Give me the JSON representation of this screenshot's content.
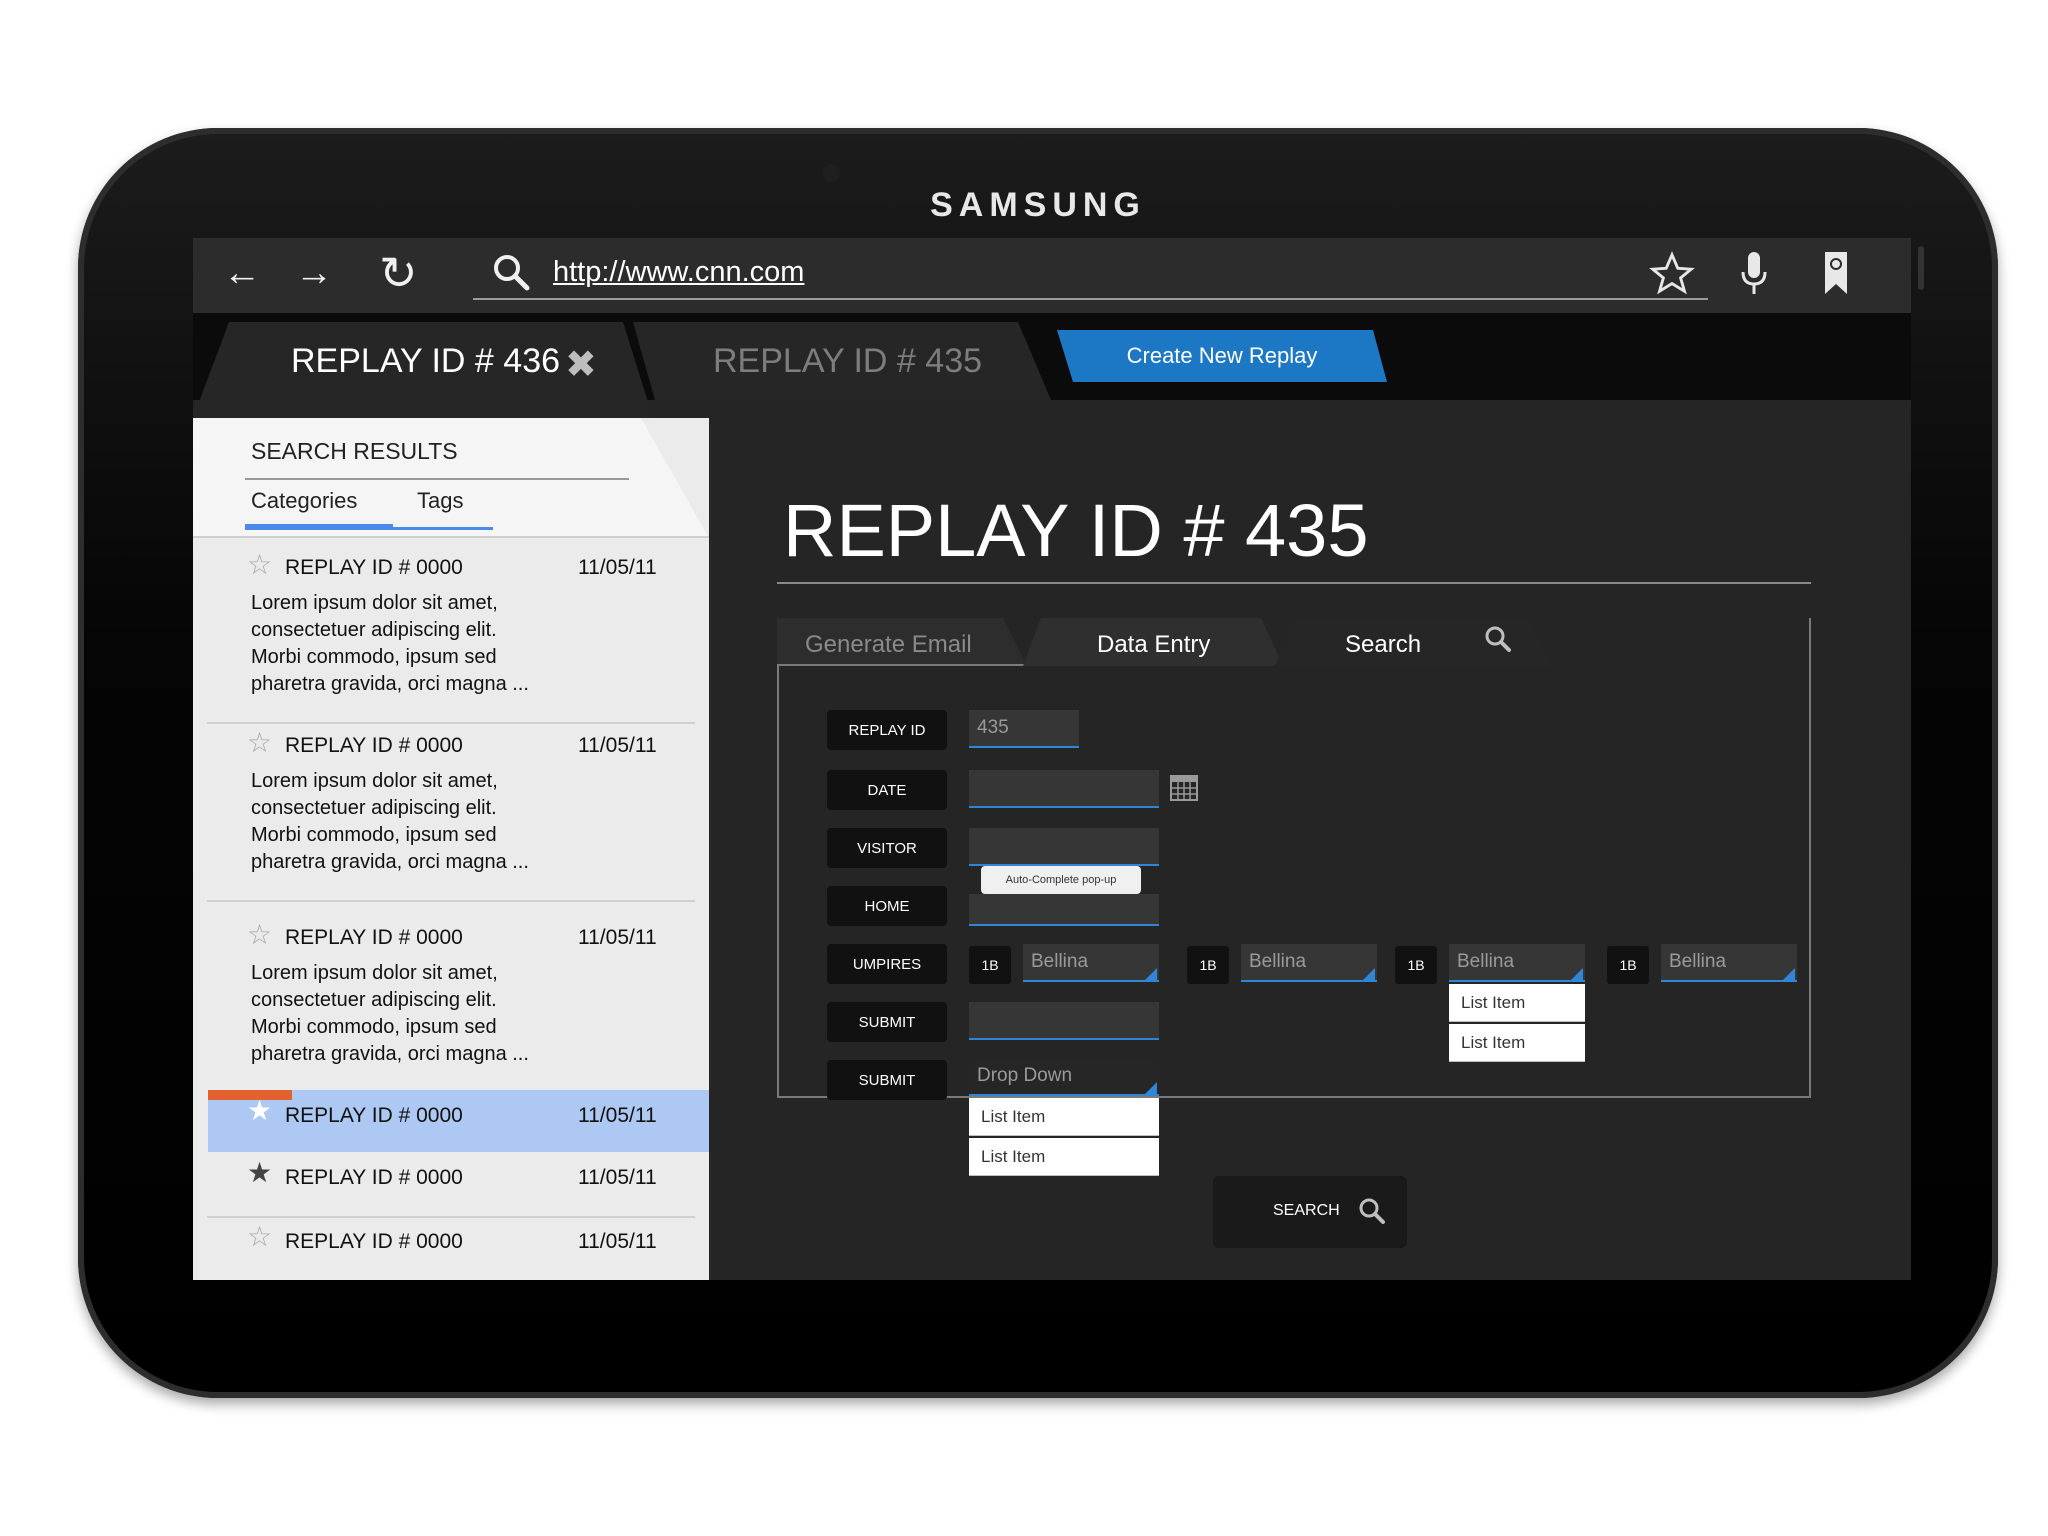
{
  "device": {
    "brand": "SAMSUNG"
  },
  "browser": {
    "url": "http://www.cnn.com",
    "icons": [
      "back-arrow-icon",
      "forward-arrow-icon",
      "refresh-icon",
      "search-icon",
      "star-icon",
      "microphone-icon",
      "bookmark-icon"
    ]
  },
  "tabs": {
    "active_label": "REPLAY ID # 436",
    "inactive_label": "REPLAY ID # 435",
    "create_new": "Create New Replay"
  },
  "results": {
    "heading": "SEARCH RESULTS",
    "tabs": [
      "Categories",
      "Tags"
    ],
    "items": [
      {
        "title": "REPLAY ID # 0000",
        "date": "11/05/11",
        "body": "Lorem ipsum dolor sit amet, consectetuer adipiscing elit. Morbi commodo, ipsum sed pharetra gravida, orci magna ...",
        "starred": false
      },
      {
        "title": "REPLAY ID # 0000",
        "date": "11/05/11",
        "body": "Lorem ipsum dolor sit amet, consectetuer adipiscing elit. Morbi commodo, ipsum sed pharetra gravida, orci magna ...",
        "starred": false
      },
      {
        "title": "REPLAY ID # 0000",
        "date": "11/05/11",
        "body": "Lorem ipsum dolor sit amet, consectetuer adipiscing elit. Morbi commodo, ipsum sed pharetra gravida, orci magna ...",
        "starred": false
      },
      {
        "title": "REPLAY ID # 0000",
        "date": "11/05/11",
        "selected": true,
        "starred": false
      },
      {
        "title": "REPLAY ID # 0000",
        "date": "11/05/11",
        "starred": true
      },
      {
        "title": "REPLAY ID # 0000",
        "date": "11/05/11",
        "starred": false
      }
    ]
  },
  "detail": {
    "title": "REPLAY ID # 435",
    "form_tabs": [
      "Generate Email",
      "Data Entry",
      "Search"
    ],
    "labels": {
      "replay_id": "REPLAY ID",
      "date": "DATE",
      "visitor": "VISITOR",
      "home": "HOME",
      "umpires": "UMPIRES",
      "submit1": "SUBMIT",
      "submit2": "SUBMIT"
    },
    "replay_id_value": "435",
    "autocomplete": "Auto-Complete pop-up",
    "umpires": [
      {
        "base": "1B",
        "name": "Bellina"
      },
      {
        "base": "1B",
        "name": "Bellina"
      },
      {
        "base": "1B",
        "name": "Bellina"
      },
      {
        "base": "1B",
        "name": "Bellina"
      }
    ],
    "umpire_list": [
      "List Item",
      "List Item"
    ],
    "dropdown_placeholder": "Drop Down",
    "dropdown_list": [
      "List Item",
      "List Item"
    ],
    "search_button": "SEARCH"
  },
  "colors": {
    "accent_blue": "#1c77c4",
    "selected_row": "#adc8f2",
    "highlight_orange": "#e2612e"
  }
}
